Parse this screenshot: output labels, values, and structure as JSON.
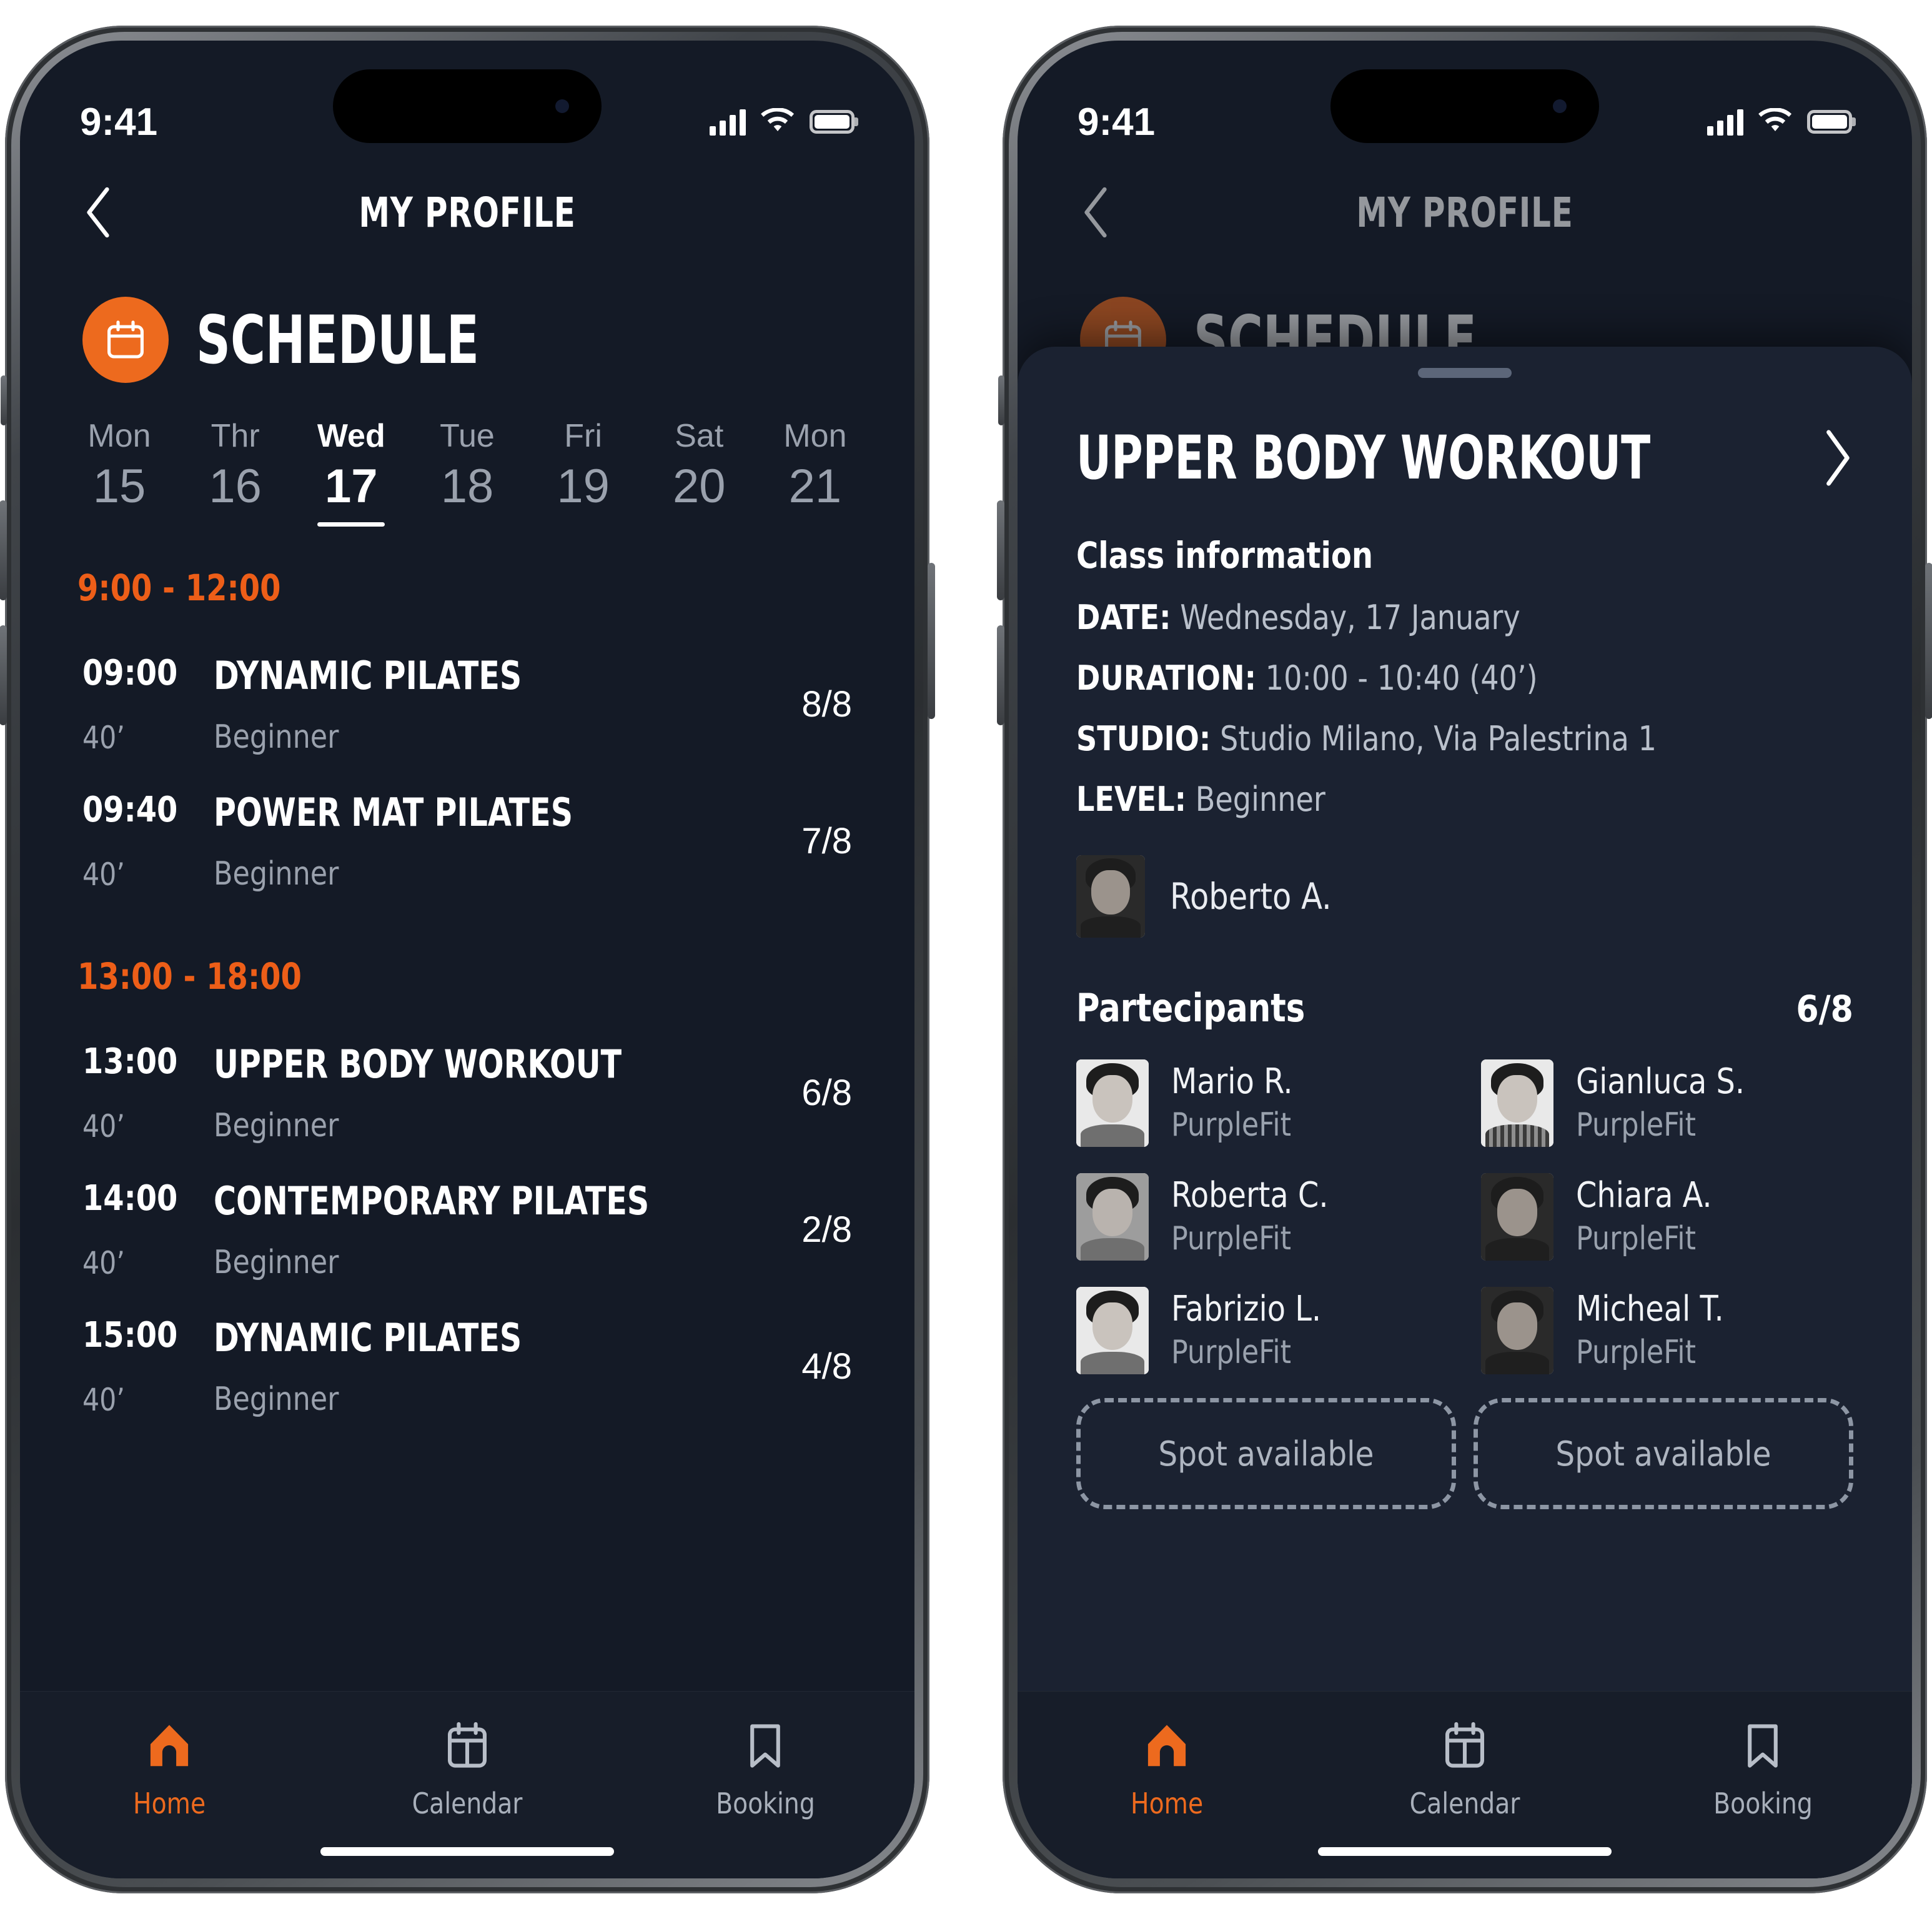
{
  "statusbar": {
    "time": "9:41"
  },
  "nav": {
    "title": "MY PROFILE",
    "back_icon": "chevron-left-icon"
  },
  "section": {
    "title": "SCHEDULE",
    "badge_icon": "calendar-icon"
  },
  "days": [
    {
      "name": "Mon",
      "num": "15",
      "active": false
    },
    {
      "name": "Thr",
      "num": "16",
      "active": false
    },
    {
      "name": "Wed",
      "num": "17",
      "active": true
    },
    {
      "name": "Tue",
      "num": "18",
      "active": false
    },
    {
      "name": "Fri",
      "num": "19",
      "active": false
    },
    {
      "name": "Sat",
      "num": "20",
      "active": false
    },
    {
      "name": "Mon",
      "num": "21",
      "active": false
    }
  ],
  "slots": [
    {
      "range": "9:00 - 12:00",
      "classes": [
        {
          "time": "09:00",
          "duration": "40’",
          "name": "DYNAMIC PILATES",
          "level": "Beginner",
          "count": "8/8"
        },
        {
          "time": "09:40",
          "duration": "40’",
          "name": "POWER MAT PILATES",
          "level": "Beginner",
          "count": "7/8"
        }
      ]
    },
    {
      "range": "13:00 - 18:00",
      "classes": [
        {
          "time": "13:00",
          "duration": "40’",
          "name": "UPPER BODY WORKOUT",
          "level": "Beginner",
          "count": "6/8"
        },
        {
          "time": "14:00",
          "duration": "40’",
          "name": "CONTEMPORARY PILATES",
          "level": "Beginner",
          "count": "2/8"
        },
        {
          "time": "15:00",
          "duration": "40’",
          "name": "DYNAMIC PILATES",
          "level": "Beginner",
          "count": "4/8"
        }
      ]
    }
  ],
  "tabs": [
    {
      "label": "Home",
      "icon": "home-icon",
      "active": true
    },
    {
      "label": "Calendar",
      "icon": "calendar-icon",
      "active": false
    },
    {
      "label": "Booking",
      "icon": "bookmark-icon",
      "active": false
    }
  ],
  "sheet": {
    "title": "UPPER BODY WORKOUT",
    "open_icon": "chevron-right-icon",
    "info_heading": "Class information",
    "info": [
      {
        "label": "DATE:",
        "value": "Wednesday, 17 January"
      },
      {
        "label": "DURATION:",
        "value": "10:00 - 10:40 (40’)"
      },
      {
        "label": "STUDIO:",
        "value": "Studio Milano, Via Palestrina 1"
      },
      {
        "label": "LEVEL:",
        "value": "Beginner"
      }
    ],
    "instructor": {
      "name": "Roberto A."
    },
    "participants_title": "Partecipants",
    "participants_count": "6/8",
    "participants": [
      {
        "name": "Mario R.",
        "org": "PurpleFit",
        "style": "light"
      },
      {
        "name": "Gianluca S.",
        "org": "PurpleFit",
        "style": "stripe"
      },
      {
        "name": "Roberta C.",
        "org": "PurpleFit",
        "style": "mid"
      },
      {
        "name": "Chiara A.",
        "org": "PurpleFit",
        "style": "dark"
      },
      {
        "name": "Fabrizio L.",
        "org": "PurpleFit",
        "style": "light"
      },
      {
        "name": "Micheal T.",
        "org": "PurpleFit",
        "style": "dark"
      }
    ],
    "spots": [
      "Spot available",
      "Spot available"
    ]
  },
  "colors": {
    "accent": "#ED6A1E",
    "slot_header": "#ED5E18",
    "screen_bg": "#141a26",
    "sheet_bg": "#1b2231",
    "muted_text": "#9aa1ad"
  }
}
